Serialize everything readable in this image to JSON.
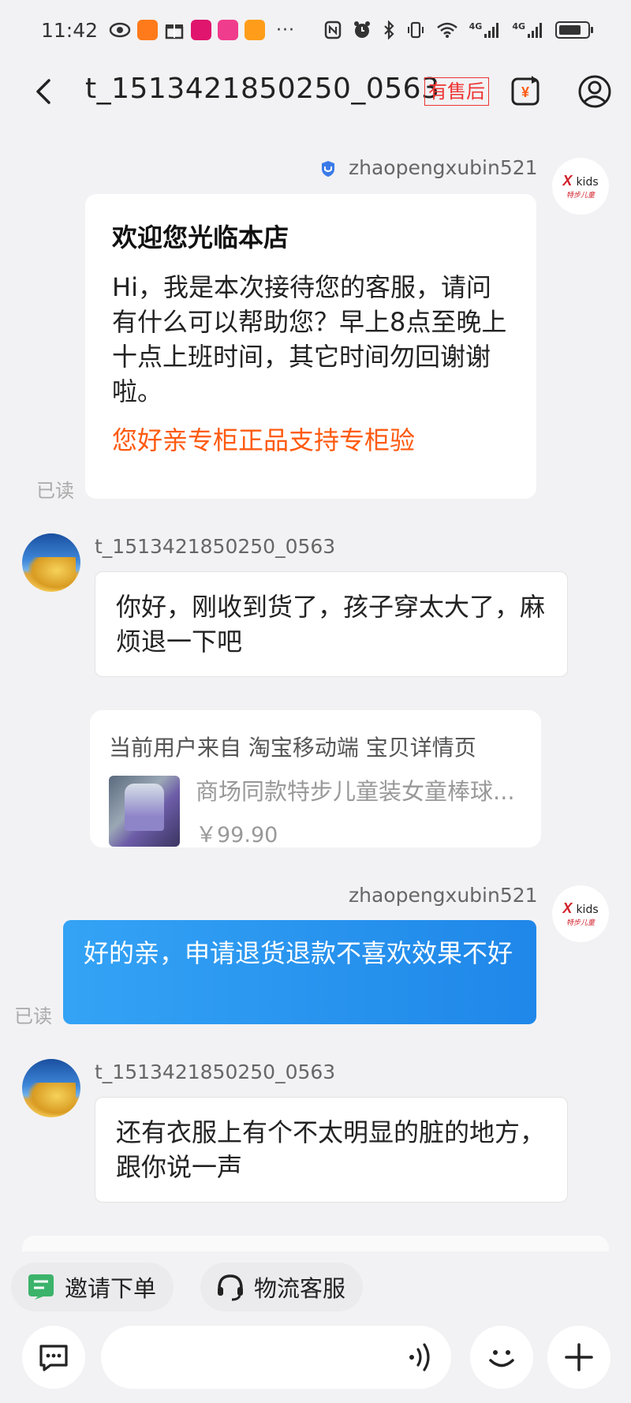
{
  "status_bar": {
    "time": "11:42",
    "more": "···",
    "network_1": "4G",
    "network_2": "4G",
    "battery_level": 0.78
  },
  "header": {
    "title": "t_1513421850250_0563",
    "after_sale_tag": "有售后"
  },
  "messages": {
    "shop_name": "zhaopengxubin521",
    "customer_name": "t_1513421850250_0563",
    "read_label": "已读",
    "welcome": {
      "title": "欢迎您光临本店",
      "body": "Hi，我是本次接待您的客服，请问有什么可以帮助您？早上8点至晚上十点上班时间，其它时间勿回谢谢啦。",
      "link": "您好亲专柜正品支持专柜验"
    },
    "customer_msg_1": "你好，刚收到货了，孩子穿太大了，麻烦退一下吧",
    "product_card": {
      "source": "当前用户来自 淘宝移动端 宝贝详情页",
      "name": "商场同款特步儿童装女童棒球...",
      "price": "￥99.90"
    },
    "shop_reply": "好的亲，申请退货退款不喜欢效果不好",
    "customer_msg_2": "还有衣服上有个不太明显的脏的地方，跟你说一声"
  },
  "brand": {
    "mark": "X",
    "kids": "kids",
    "sub": "特步儿童"
  },
  "shortcuts": {
    "invite_order": "邀请下单",
    "logistics_service": "物流客服"
  },
  "input": {
    "placeholder": ""
  },
  "colors": {
    "accent_orange": "#ff5a10",
    "tag_red": "#e33333",
    "bubble_blue": "#2b94ef",
    "verify_blue": "#3b7be8"
  }
}
